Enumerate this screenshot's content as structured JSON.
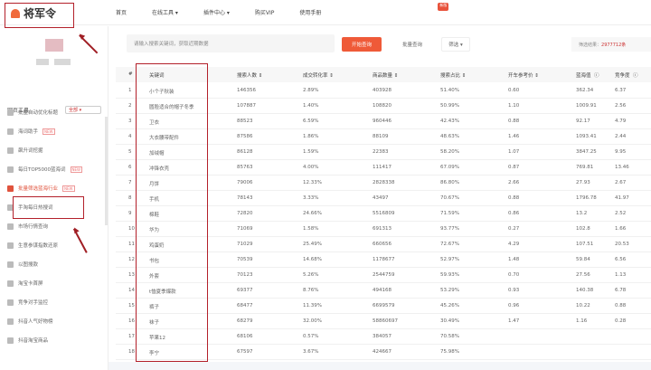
{
  "header": {
    "logo": "将军令",
    "nav": [
      "首页",
      "在线工具 ▾",
      "插件中心 ▾",
      "购买VIP",
      "使用手册"
    ],
    "badge": "新版"
  },
  "sidebar": {
    "title": "网页工具",
    "select": "全部 ▾",
    "new_tag": "NEW",
    "items": [
      {
        "label": "批量自动优化标题",
        "new": false
      },
      {
        "label": "海词助手",
        "new": true
      },
      {
        "label": "飙升词挖掘",
        "new": false
      },
      {
        "label": "每日TOP5000蓝海词",
        "new": true
      },
      {
        "label": "批量筛选蓝海行业",
        "new": true,
        "active": true
      },
      {
        "label": "手淘每日热搜词",
        "new": false
      },
      {
        "label": "市场行情查询",
        "new": false
      },
      {
        "label": "生意参谋指数还原",
        "new": false
      },
      {
        "label": "以图搜款",
        "new": false
      },
      {
        "label": "淘宝卡首屏",
        "new": false
      },
      {
        "label": "竞争对手监控",
        "new": false
      },
      {
        "label": "抖音人气好物榜",
        "new": false
      },
      {
        "label": "抖音淘宝商品",
        "new": false
      }
    ]
  },
  "search": {
    "placeholder": "请输入搜索关键词，获取近期数据",
    "go": "开始查询",
    "batch": "批量查询",
    "filter": "筛选 ▾",
    "result_label": "筛选结果：",
    "result_count": "2977712条"
  },
  "table": {
    "headers": [
      "#",
      "关键词",
      "搜索人数 ⇕",
      "成交转化率 ⇕",
      "商品数量 ⇕",
      "搜索占比 ⇕",
      "开车参考价 ⇕",
      "蓝海值",
      "竞争度"
    ],
    "help": "ⓘ",
    "rows": [
      [
        "1",
        "小个子秋装",
        "146356",
        "2.89%",
        "403928",
        "51.40%",
        "0.60",
        "362.34",
        "6.37"
      ],
      [
        "2",
        "圆脸适合的帽子冬季",
        "107887",
        "1.40%",
        "108820",
        "50.99%",
        "1.10",
        "1009.91",
        "2.56"
      ],
      [
        "3",
        "卫衣",
        "88523",
        "6.59%",
        "960446",
        "42.43%",
        "0.88",
        "92.17",
        "4.79"
      ],
      [
        "4",
        "大衣腰带配件",
        "87586",
        "1.86%",
        "88109",
        "48.63%",
        "1.46",
        "1093.41",
        "2.44"
      ],
      [
        "5",
        "加绒帽",
        "86128",
        "1.59%",
        "22383",
        "58.20%",
        "1.07",
        "3847.25",
        "9.95"
      ],
      [
        "6",
        "冲锋衣壳",
        "85763",
        "4.00%",
        "111417",
        "67.09%",
        "0.87",
        "769.81",
        "13.46"
      ],
      [
        "7",
        "月饼",
        "79006",
        "12.33%",
        "2828338",
        "86.80%",
        "2.66",
        "27.93",
        "2.67"
      ],
      [
        "8",
        "手机",
        "78143",
        "3.33%",
        "43497",
        "70.67%",
        "0.88",
        "1796.78",
        "41.97"
      ],
      [
        "9",
        "棉鞋",
        "72820",
        "24.66%",
        "5516809",
        "71.59%",
        "0.86",
        "13.2",
        "2.52"
      ],
      [
        "10",
        "华为",
        "71069",
        "1.58%",
        "691313",
        "93.77%",
        "0.27",
        "102.8",
        "1.66"
      ],
      [
        "11",
        "鸡蛋奶",
        "71029",
        "25.49%",
        "660656",
        "72.67%",
        "4.29",
        "107.51",
        "20.53"
      ],
      [
        "12",
        "书包",
        "70539",
        "14.68%",
        "1178677",
        "52.97%",
        "1.48",
        "59.84",
        "6.56"
      ],
      [
        "13",
        "外套",
        "70123",
        "5.26%",
        "2544759",
        "59.93%",
        "0.70",
        "27.56",
        "1.13"
      ],
      [
        "14",
        "t恤夏季爆款",
        "69377",
        "8.76%",
        "494168",
        "53.29%",
        "0.93",
        "140.38",
        "6.78"
      ],
      [
        "15",
        "裤子",
        "68477",
        "11.39%",
        "6699579",
        "45.26%",
        "0.96",
        "10.22",
        "0.88"
      ],
      [
        "16",
        "袜子",
        "68279",
        "32.00%",
        "58860697",
        "30.49%",
        "1.47",
        "1.16",
        "0.28"
      ],
      [
        "17",
        "苹果12",
        "68106",
        "0.57%",
        "384057",
        "70.58%",
        "",
        "",
        ""
      ],
      [
        "18",
        "李宁",
        "67597",
        "3.67%",
        "424667",
        "75.98%",
        "",
        "",
        ""
      ]
    ]
  }
}
